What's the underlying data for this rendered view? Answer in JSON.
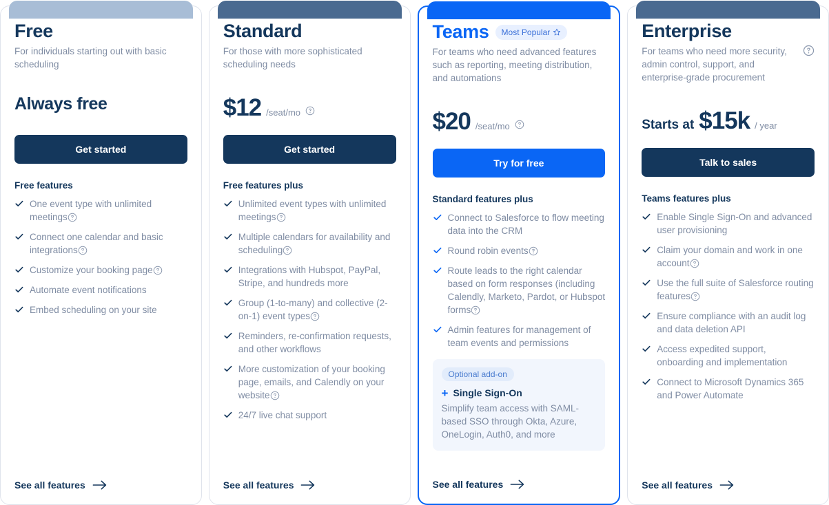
{
  "plans": [
    {
      "id": "free",
      "name": "Free",
      "accent_color": "#a8bdd6",
      "description": "For individuals starting out with basic scheduling",
      "has_desc_help": false,
      "price_prefix": "",
      "price_free_label": "Always free",
      "price_amount": "",
      "price_unit": "",
      "price_has_help": false,
      "cta_label": "Get started",
      "cta_style": "dark",
      "featured": false,
      "badge": null,
      "features_heading": "Free features",
      "features": [
        {
          "text": "One event type with unlimited meetings",
          "help": true
        },
        {
          "text": "Connect one calendar and basic integrations",
          "help": true
        },
        {
          "text": "Customize your booking page",
          "help": true
        },
        {
          "text": "Automate event notifications",
          "help": false
        },
        {
          "text": "Embed scheduling on your site",
          "help": false
        }
      ],
      "addon": null,
      "footer_link": "See all features"
    },
    {
      "id": "standard",
      "name": "Standard",
      "accent_color": "#4a6a90",
      "description": "For those with more sophisticated scheduling needs",
      "has_desc_help": false,
      "price_prefix": "",
      "price_free_label": "",
      "price_amount": "$12",
      "price_unit": "/seat/mo",
      "price_has_help": true,
      "cta_label": "Get started",
      "cta_style": "dark",
      "featured": false,
      "badge": null,
      "features_heading": "Free features plus",
      "features": [
        {
          "text": "Unlimited event types with unlimited meetings",
          "help": true
        },
        {
          "text": "Multiple calendars for availability and scheduling",
          "help": true
        },
        {
          "text": "Integrations with Hubspot, PayPal, Stripe, and hundreds more",
          "help": false
        },
        {
          "text": "Group (1-to-many) and collective (2-on-1) event types",
          "help": true
        },
        {
          "text": "Reminders, re-confirmation requests, and other workflows",
          "help": false
        },
        {
          "text": "More customization of your booking page, emails, and Calendly on your website",
          "help": true
        },
        {
          "text": "24/7 live chat support",
          "help": false
        }
      ],
      "addon": null,
      "footer_link": "See all features"
    },
    {
      "id": "teams",
      "name": "Teams",
      "accent_color": "#0a66f5",
      "description": "For teams who need advanced features such as reporting, meeting distribution, and automations",
      "has_desc_help": false,
      "price_prefix": "",
      "price_free_label": "",
      "price_amount": "$20",
      "price_unit": "/seat/mo",
      "price_has_help": true,
      "cta_label": "Try for free",
      "cta_style": "primary",
      "featured": true,
      "badge": "Most Popular",
      "features_heading": "Standard features plus",
      "features": [
        {
          "text": "Connect to Salesforce to flow meeting data into the CRM",
          "help": false
        },
        {
          "text": "Round robin events",
          "help": true
        },
        {
          "text": "Route leads to the right calendar based on form responses (including Calendly, Marketo, Pardot, or Hubspot forms",
          "help": true
        },
        {
          "text": "Admin features for management of team events and permissions",
          "help": false
        }
      ],
      "addon": {
        "badge": "Optional add-on",
        "title": "Single Sign-On",
        "description": "Simplify team access with SAML-based SSO through Okta, Azure, OneLogin, Auth0, and more"
      },
      "footer_link": "See all features"
    },
    {
      "id": "enterprise",
      "name": "Enterprise",
      "accent_color": "#4a6a90",
      "description": "For teams who need more security, admin control, support, and enterprise-grade procurement",
      "has_desc_help": true,
      "price_prefix": "Starts at",
      "price_free_label": "",
      "price_amount": "$15k",
      "price_unit": "/ year",
      "price_has_help": false,
      "cta_label": "Talk to sales",
      "cta_style": "dark",
      "featured": false,
      "badge": null,
      "features_heading": "Teams features plus",
      "features": [
        {
          "text": "Enable Single Sign-On and advanced user provisioning",
          "help": false
        },
        {
          "text": "Claim your domain and work in one account",
          "help": true
        },
        {
          "text": "Use the full suite of Salesforce routing features",
          "help": true
        },
        {
          "text": "Ensure compliance with an audit log and data deletion API",
          "help": false
        },
        {
          "text": "Access expedited support, onboarding and implementation",
          "help": false
        },
        {
          "text": "Connect to Microsoft Dynamics 365 and Power Automate",
          "help": false
        }
      ],
      "addon": null,
      "footer_link": "See all features"
    }
  ],
  "icons": {
    "check": "check-icon",
    "help": "help-circle-icon",
    "arrow": "arrow-right-icon",
    "star": "star-outline-icon",
    "plus": "plus-icon"
  },
  "colors": {
    "brand_blue": "#0a66f5",
    "navy": "#14375c",
    "muted": "#7f8ca3",
    "addon_bg": "#f2f6fd"
  }
}
